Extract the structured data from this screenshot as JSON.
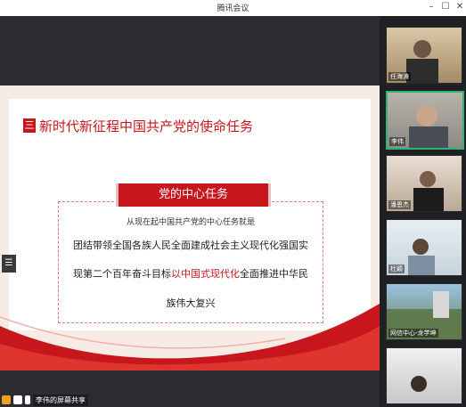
{
  "window": {
    "title": "腾讯会议",
    "minimize": "–",
    "maximize": "☐",
    "close": "✕"
  },
  "slide": {
    "section_number": "三",
    "section_title": "新时代新征程中国共产党的使命任务",
    "banner": "党的中心任务",
    "lead": "从现在起中国共产党的中心任务就是",
    "line1": "团结带领全国各族人民全面建成社会主义现代化强国实",
    "line2_before": "现第二个百年奋斗目标",
    "line2_highlight": "以中国式现代化",
    "line2_after": "全面推进中华民",
    "line3": "族伟大复兴"
  },
  "share": {
    "label": "李伟的屏幕共享",
    "list_icon": "☰"
  },
  "participants": [
    {
      "name": "任海涛"
    },
    {
      "name": "李伟"
    },
    {
      "name": "潘恩杰"
    },
    {
      "name": "杜颖"
    },
    {
      "name": "网信中心-龙学坤"
    },
    {
      "name": ""
    }
  ]
}
